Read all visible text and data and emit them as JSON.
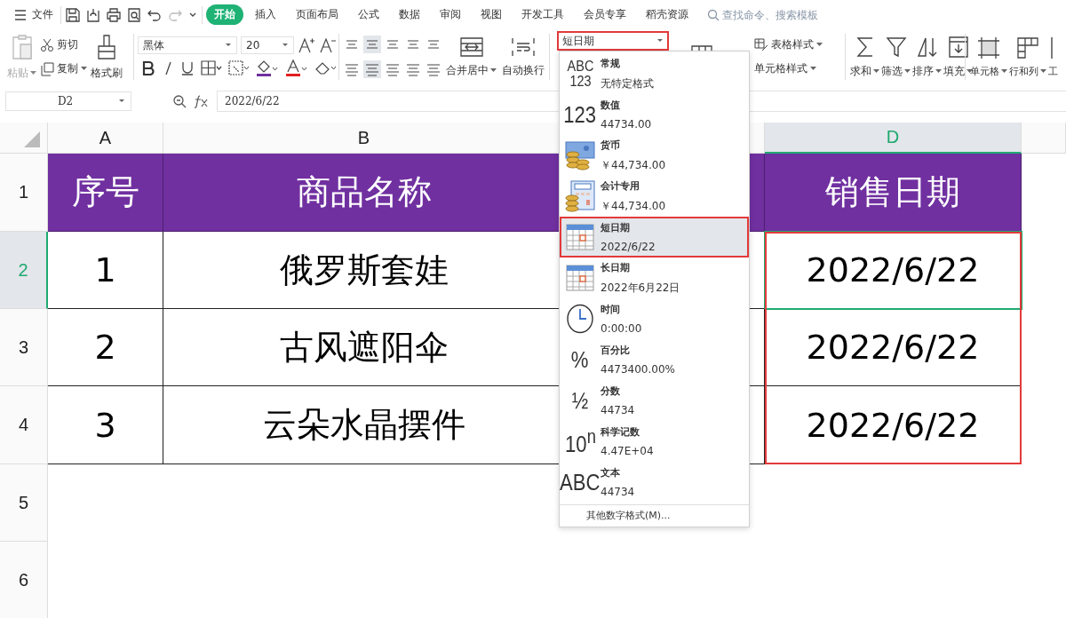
{
  "menu": {
    "file": "文件"
  },
  "tabs": [
    {
      "label": "开始",
      "selected": true
    },
    {
      "label": "插入",
      "selected": false
    },
    {
      "label": "页面布局",
      "selected": false
    },
    {
      "label": "公式",
      "selected": false
    },
    {
      "label": "数据",
      "selected": false
    },
    {
      "label": "审阅",
      "selected": false
    },
    {
      "label": "视图",
      "selected": false
    },
    {
      "label": "开发工具",
      "selected": false
    },
    {
      "label": "会员专享",
      "selected": false
    },
    {
      "label": "稻壳资源",
      "selected": false
    }
  ],
  "search": {
    "placeholder": "查找命令、搜索模板"
  },
  "ribbon": {
    "paste": {
      "label": "粘贴",
      "disabled": true
    },
    "cut": "剪切",
    "copy": "复制",
    "format_painter": "格式刷",
    "font_name": "黑体",
    "font_size": "20",
    "merge": "合并居中",
    "wrap": "自动换行",
    "number_format": {
      "value": "短日期",
      "highlighted": true
    },
    "table_style": "表格样式",
    "cell_style": "单元格样式",
    "sum": "求和",
    "filter": "筛选",
    "sort": "排序",
    "fill": "填充",
    "cell": "单元格",
    "rows_cols": "行和列",
    "worksheet": "工"
  },
  "formula_bar": {
    "name_box": "D2",
    "value": "2022/6/22"
  },
  "sheet": {
    "highlight_range": true,
    "columns": [
      {
        "label": "A",
        "selected": false
      },
      {
        "label": "B",
        "selected": false
      },
      {
        "selected": false
      },
      {
        "label": "D",
        "selected": true
      },
      {
        "selected": false
      }
    ],
    "rows": [
      {
        "header": "1",
        "kind": "header",
        "selected": false,
        "cells": [
          "序号",
          "商品名称",
          null,
          "销售日期"
        ]
      },
      {
        "header": "2",
        "kind": "data",
        "selected": true,
        "cells": [
          "1",
          "俄罗斯套娃",
          null,
          "2022/6/22"
        ]
      },
      {
        "header": "3",
        "kind": "data",
        "selected": false,
        "cells": [
          "2",
          "古风遮阳伞",
          null,
          "2022/6/22"
        ]
      },
      {
        "header": "4",
        "kind": "data",
        "selected": false,
        "cells": [
          "3",
          "云朵水晶摆件",
          null,
          "2022/6/22"
        ]
      },
      {
        "header": "5",
        "kind": "empty",
        "selected": false,
        "cells": []
      },
      {
        "header": "6",
        "kind": "empty",
        "selected": false,
        "cells": []
      }
    ]
  },
  "format_menu": {
    "items": [
      {
        "kind": "glyph",
        "glyph": [
          "ABC",
          "123"
        ],
        "name": "常规",
        "example": "无特定格式",
        "selected": false,
        "highlighted": false
      },
      {
        "kind": "glyph",
        "glyph": [
          "123"
        ],
        "name": "数值",
        "example": "44734.00",
        "selected": false,
        "highlighted": false
      },
      {
        "kind": "currency",
        "name": "货币",
        "example": "￥44,734.00",
        "selected": false,
        "highlighted": false
      },
      {
        "kind": "accounting",
        "name": "会计专用",
        "example": " ￥44,734.00",
        "selected": false,
        "highlighted": false
      },
      {
        "kind": "calendar",
        "name": "短日期",
        "example": "2022/6/22",
        "selected": true,
        "highlighted": true
      },
      {
        "kind": "calendar",
        "name": "长日期",
        "example": "2022年6月22日",
        "selected": false,
        "highlighted": false
      },
      {
        "kind": "clock",
        "name": "时间",
        "example": "0:00:00",
        "selected": false,
        "highlighted": false
      },
      {
        "kind": "glyph",
        "glyph": [
          "%"
        ],
        "name": "百分比",
        "example": "4473400.00%",
        "selected": false,
        "highlighted": false
      },
      {
        "kind": "glyph",
        "glyph": [
          "½"
        ],
        "name": "分数",
        "example": "44734",
        "selected": false,
        "highlighted": false
      },
      {
        "kind": "glyph",
        "glyph": [
          "10$^{n}$"
        ],
        "name": "科学记数",
        "example": "4.47E+04",
        "selected": false,
        "highlighted": false
      },
      {
        "kind": "glyph",
        "glyph": [
          "ABC"
        ],
        "name": "文本",
        "example": "44734",
        "selected": false,
        "highlighted": false
      }
    ],
    "more": "其他数字格式(M)..."
  }
}
